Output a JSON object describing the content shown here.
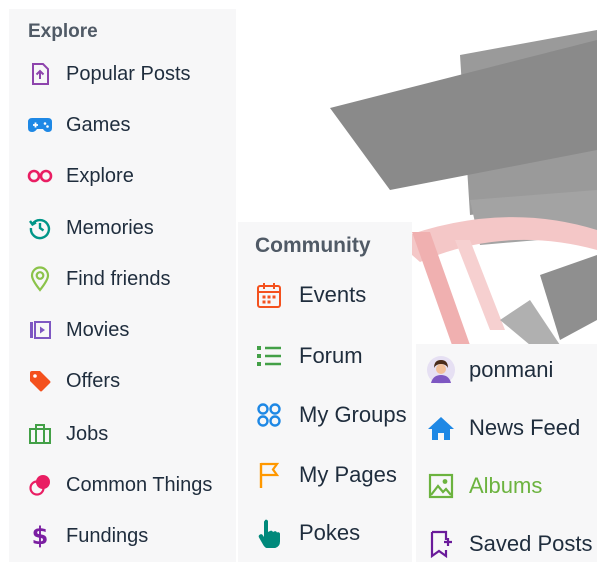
{
  "explore_menu": {
    "title": "Explore",
    "items": [
      {
        "label": "Popular Posts",
        "icon": "document-upload-icon",
        "color": "#8e44ad"
      },
      {
        "label": "Games",
        "icon": "gamepad-icon",
        "color": "#1e88e5"
      },
      {
        "label": "Explore",
        "icon": "glasses-icon",
        "color": "#e91e63"
      },
      {
        "label": "Memories",
        "icon": "history-icon",
        "color": "#009688"
      },
      {
        "label": "Find friends",
        "icon": "location-pin-icon",
        "color": "#8bc34a"
      },
      {
        "label": "Movies",
        "icon": "film-icon",
        "color": "#7e57c2"
      },
      {
        "label": "Offers",
        "icon": "tag-icon",
        "color": "#f4511e"
      },
      {
        "label": "Jobs",
        "icon": "briefcase-icon",
        "color": "#43a047"
      },
      {
        "label": "Common Things",
        "icon": "circles-icon",
        "color": "#e91e63"
      },
      {
        "label": "Fundings",
        "icon": "dollar-icon",
        "color": "#7b1fa2"
      }
    ]
  },
  "community_menu": {
    "title": "Community",
    "items": [
      {
        "label": "Events",
        "icon": "calendar-icon",
        "color": "#f4511e"
      },
      {
        "label": "Forum",
        "icon": "list-icon",
        "color": "#43a047"
      },
      {
        "label": "My Groups",
        "icon": "groups-icon",
        "color": "#1e88e5"
      },
      {
        "label": "My Pages",
        "icon": "flag-icon",
        "color": "#ff9800"
      },
      {
        "label": "Pokes",
        "icon": "pointing-hand-icon",
        "color": "#00897b"
      }
    ]
  },
  "user_menu": {
    "items": [
      {
        "label": "ponmani",
        "icon": "avatar-icon"
      },
      {
        "label": "News Feed",
        "icon": "home-icon",
        "color": "#1e88e5"
      },
      {
        "label": "Albums",
        "icon": "image-icon",
        "color": "#6cb33f",
        "active": true
      },
      {
        "label": "Saved Posts",
        "icon": "bookmark-add-icon",
        "color": "#6a1b9a"
      }
    ]
  }
}
